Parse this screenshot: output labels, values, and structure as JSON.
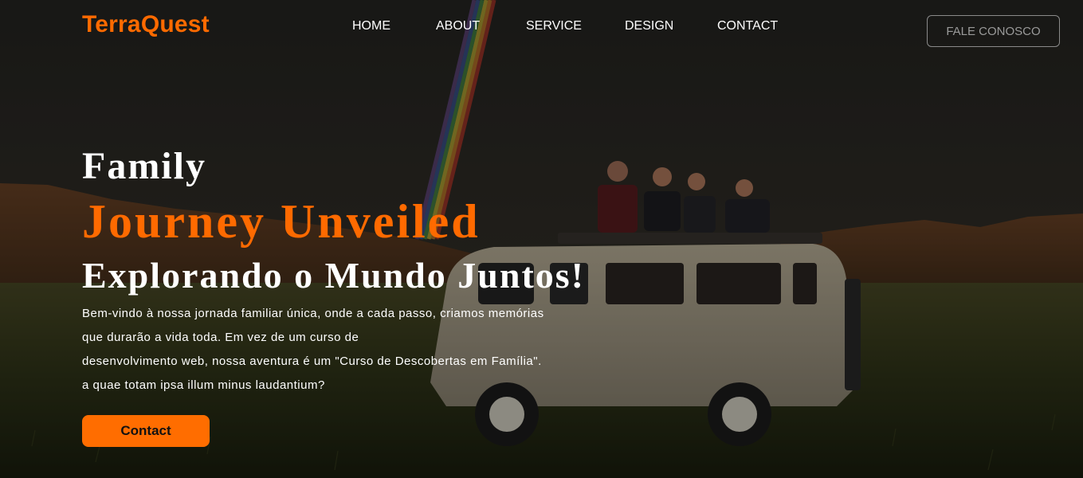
{
  "brand": {
    "logo_text": "TerraQuest",
    "accent_color": "#ff6a00"
  },
  "nav": {
    "items": [
      {
        "label": "HOME"
      },
      {
        "label": "ABOUT"
      },
      {
        "label": "SERVICE"
      },
      {
        "label": "DESIGN"
      },
      {
        "label": "CONTACT"
      }
    ],
    "cta_label": "FALE CONOSCO"
  },
  "hero": {
    "title_line1": "Family",
    "title_line2": "Journey Unveiled",
    "title_line3": "Explorando o Mundo Juntos!",
    "description_lines": [
      "Bem-vindo à nossa jornada familiar única, onde a cada passo, criamos memórias",
      "que durarão a vida toda. Em vez de um curso de",
      "desenvolvimento web, nossa aventura é um \"Curso de Descobertas em Família\".",
      "a quae totam ipsa illum minus laudantium?"
    ],
    "button_label": "Contact"
  }
}
